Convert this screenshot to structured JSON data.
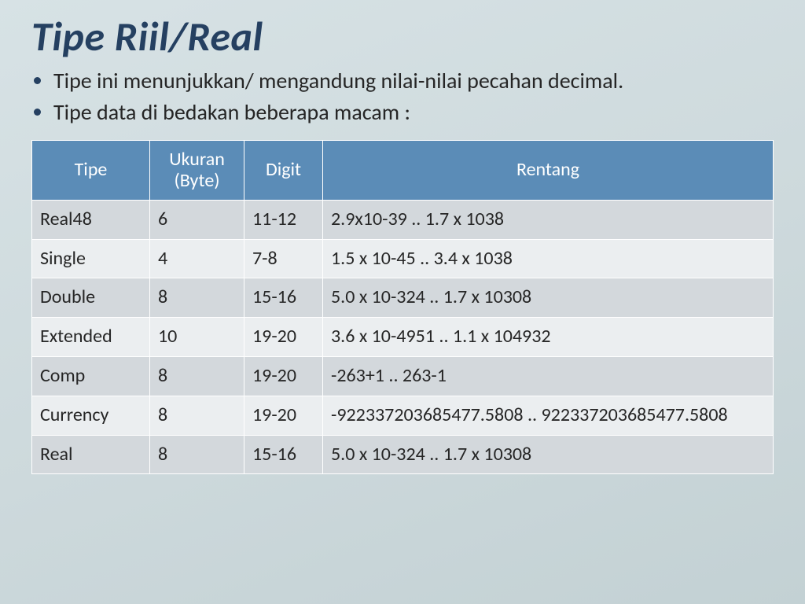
{
  "title": "Tipe Riil/Real",
  "bullets": [
    "Tipe ini menunjukkan/ mengandung nilai-nilai pecahan decimal.",
    "Tipe data di bedakan beberapa macam :"
  ],
  "table": {
    "headers": [
      "Tipe",
      "Ukuran (Byte)",
      "Digit",
      "Rentang"
    ],
    "rows": [
      [
        "Real48",
        "6",
        "11-12",
        "2.9x10-39 .. 1.7 x 1038"
      ],
      [
        "Single",
        "4",
        "7-8",
        "1.5 x 10-45 .. 3.4 x 1038"
      ],
      [
        "Double",
        "8",
        "15-16",
        "5.0 x 10-324 .. 1.7 x 10308"
      ],
      [
        "Extended",
        "10",
        "19-20",
        "3.6 x 10-4951 .. 1.1 x 104932"
      ],
      [
        "Comp",
        "8",
        "19-20",
        "-263+1 .. 263-1"
      ],
      [
        "Currency",
        "8",
        "19-20",
        "-922337203685477.5808 .. 922337203685477.5808"
      ],
      [
        "Real",
        "8",
        "15-16",
        "5.0 x 10-324 .. 1.7 x 10308"
      ]
    ]
  }
}
